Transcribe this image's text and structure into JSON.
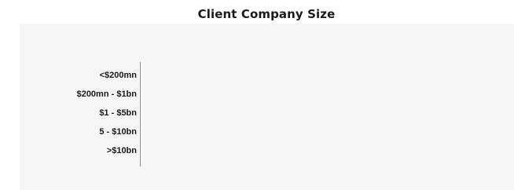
{
  "chart_data": {
    "type": "bar",
    "orientation": "horizontal",
    "title": "Client Company Size",
    "xlabel": "",
    "ylabel": "",
    "categories": [
      "<$200mn",
      "$200mn - $1bn",
      "$1 - $5bn",
      "5 - $10bn",
      ">$10bn"
    ],
    "values": [
      0,
      0,
      0,
      0,
      0
    ],
    "xlim": [
      0,
      1
    ],
    "grid": false,
    "legend": "none",
    "colors": {
      "background": "#f6f6f6",
      "axis": "#8c8c8c",
      "bar": "#4472c4",
      "text": "#1a1a1a"
    }
  }
}
